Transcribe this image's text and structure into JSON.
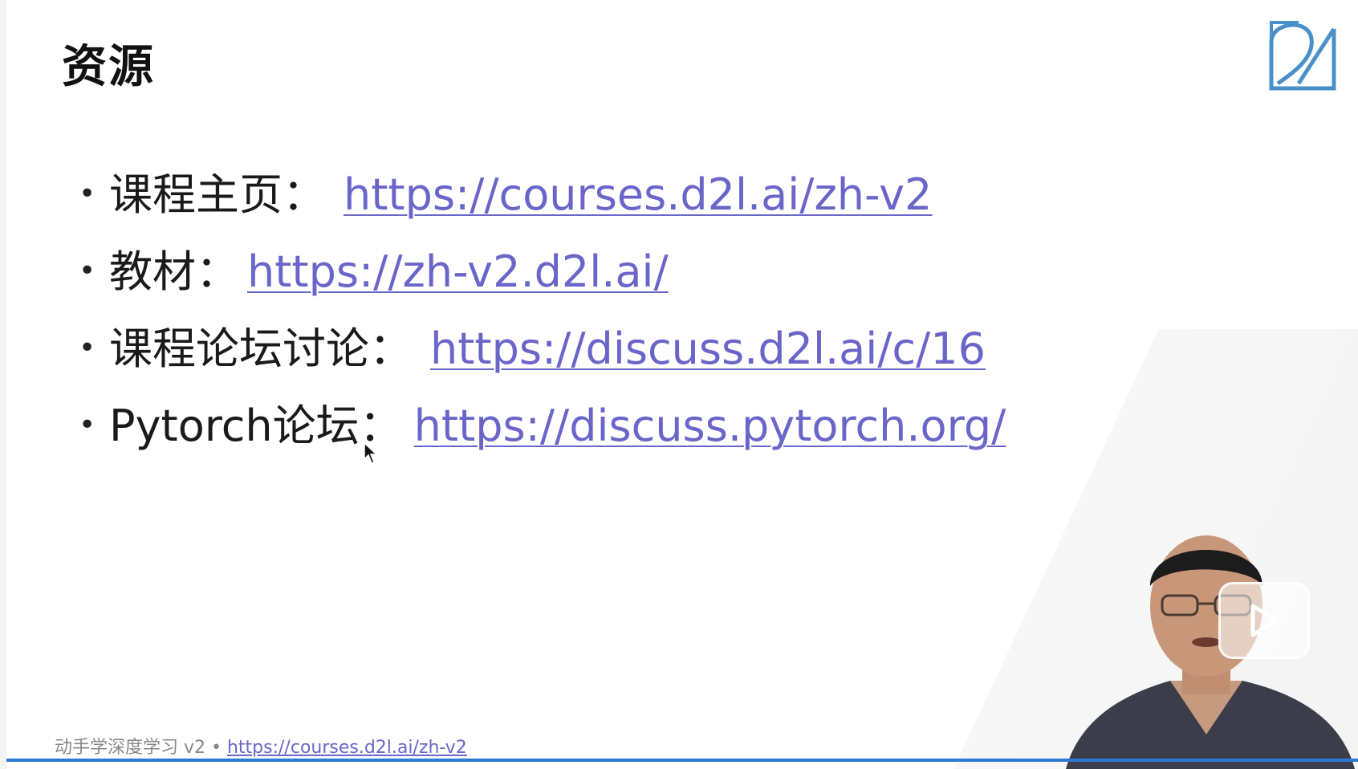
{
  "slide": {
    "title": "资源",
    "bullets": [
      {
        "label": "课程主页：",
        "url": "https://courses.d2l.ai/zh-v2"
      },
      {
        "label": "教材：",
        "url": "https://zh-v2.d2l.ai/"
      },
      {
        "label": "课程论坛讨论：",
        "url": "https://discuss.d2l.ai/c/16"
      },
      {
        "label": "Pytorch论坛：",
        "url": "https://discuss.pytorch.org/"
      }
    ],
    "bullet_glyph": "•"
  },
  "footer": {
    "text": "动手学深度学习 v2 • ",
    "link": "https://courses.d2l.ai/zh-v2"
  },
  "colors": {
    "link": "#6a66c9",
    "progress": "#2a7ad6",
    "logo": "#4a90c8"
  },
  "icons": [
    "d2l-logo-icon",
    "mouse-cursor-icon",
    "bilibili-play-icon"
  ]
}
